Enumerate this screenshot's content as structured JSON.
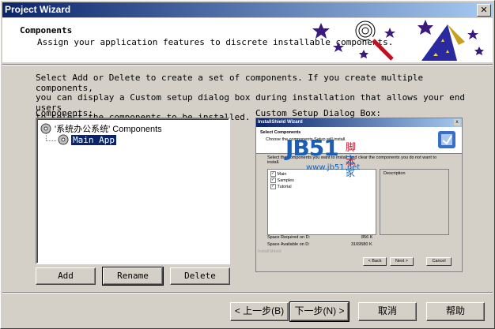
{
  "window": {
    "title": "Project Wizard",
    "close_label": "✕"
  },
  "header": {
    "title": "Components",
    "subtitle": "Assign your application features to discrete installable components."
  },
  "instructions": [
    "Select Add or Delete to create a set of components.  If you create multiple components,",
    "you can display a Custom setup dialog box during installation that allows your end users",
    "to select the components to be installed."
  ],
  "components_label": "Components:",
  "preview_label": "Custom Setup Dialog Box:",
  "tree": {
    "root_label": "'系统办公系统' Components",
    "child_label": "Main App"
  },
  "component_buttons": {
    "add": "Add",
    "rename": "Rename",
    "delete": "Delete"
  },
  "preview": {
    "title": "InstallShield Wizard",
    "close": "x",
    "header_title": "Select Components",
    "header_sub": "Choose the components Setup will install.",
    "instruction": "Select the components you want to install, and clear the components you do not want to install.",
    "items": [
      "Main",
      "Samples",
      "Tutorial"
    ],
    "description_label": "Description",
    "space_required": "Space Required on  D:",
    "space_required_value": "856 K",
    "space_available": "Space Available on  D:",
    "space_available_value": "3169580 K",
    "footer_brand": "InstallShield",
    "btn_back": "< Back",
    "btn_next": "Next >",
    "btn_cancel": "Cancel"
  },
  "watermark": {
    "logo": "JB51",
    "cn1": "脚本",
    "cn2": "之家",
    "url": "www.jb51.net"
  },
  "nav_buttons": {
    "back": "< 上一步(B)",
    "next": "下一步(N) >",
    "cancel": "取消",
    "help": "帮助"
  },
  "colors": {
    "title_bar": "#0a246a",
    "face": "#d4d0c8",
    "selection": "#0a246a",
    "star": "#3a1a7a",
    "watermark_blue": "#1a5fb4",
    "watermark_red": "#d0102a"
  }
}
